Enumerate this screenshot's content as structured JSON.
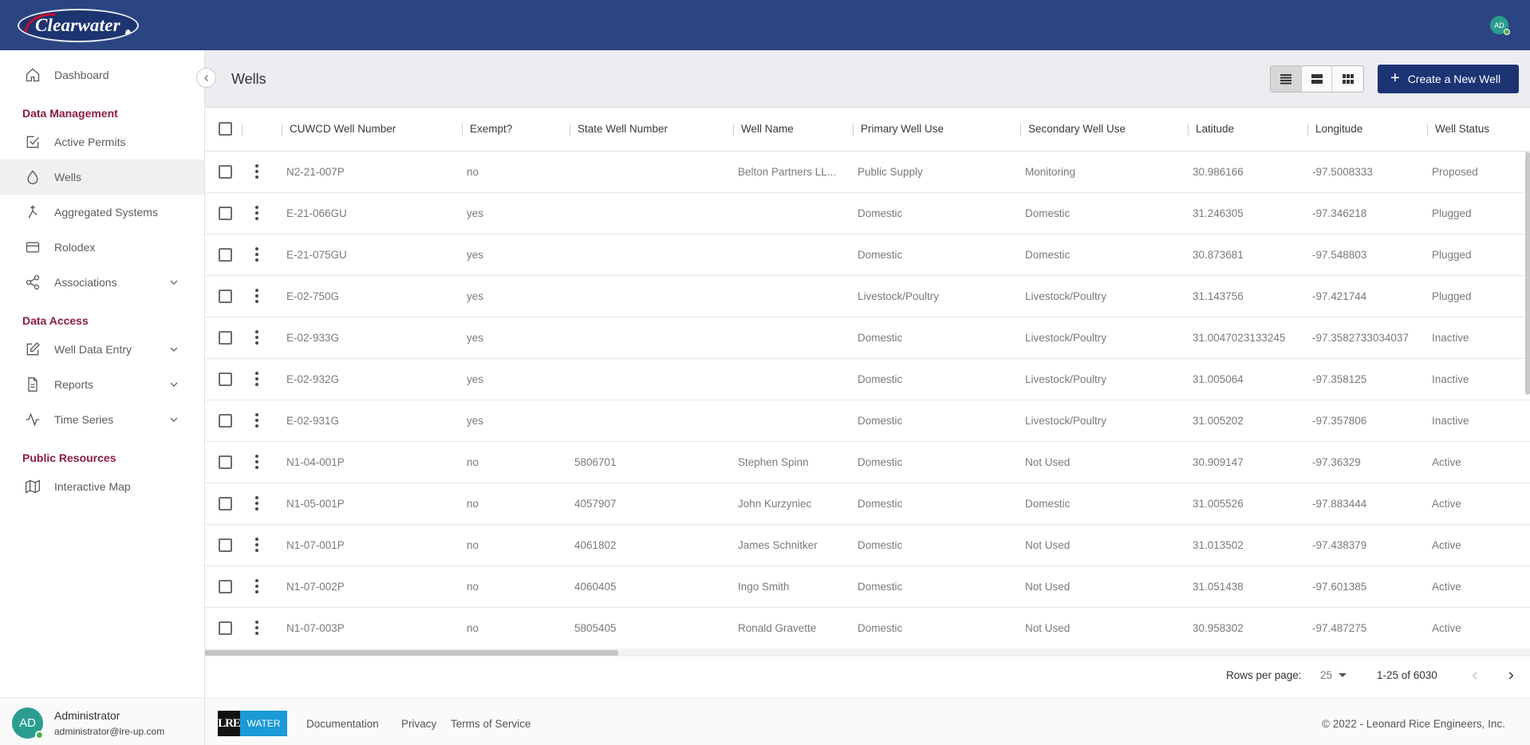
{
  "brand": {
    "logo_text": "Clearwater",
    "user_initials": "AD"
  },
  "sidebar": {
    "dashboard": "Dashboard",
    "sections": {
      "data_management": "Data Management",
      "data_access": "Data Access",
      "public_resources": "Public Resources"
    },
    "items": {
      "active_permits": "Active Permits",
      "wells": "Wells",
      "aggregated_systems": "Aggregated Systems",
      "rolodex": "Rolodex",
      "associations": "Associations",
      "well_data_entry": "Well Data Entry",
      "reports": "Reports",
      "time_series": "Time Series",
      "interactive_map": "Interactive Map"
    },
    "active_item": "Wells"
  },
  "user": {
    "initials": "AD",
    "name": "Administrator",
    "email": "administrator@lre-up.com"
  },
  "header": {
    "title": "Wells",
    "create_label": "Create a New Well"
  },
  "table": {
    "columns": [
      "CUWCD Well Number",
      "Exempt?",
      "State Well Number",
      "Well Name",
      "Primary Well Use",
      "Secondary Well Use",
      "Latitude",
      "Longitude",
      "Well Status"
    ],
    "rows": [
      [
        "N2-21-007P",
        "no",
        "",
        "Belton Partners LL...",
        "Public Supply",
        "Monitoring",
        "30.986166",
        "-97.5008333",
        "Proposed"
      ],
      [
        "E-21-066GU",
        "yes",
        "",
        "",
        "Domestic",
        "Domestic",
        "31.246305",
        "-97.346218",
        "Plugged"
      ],
      [
        "E-21-075GU",
        "yes",
        "",
        "",
        "Domestic",
        "Domestic",
        "30.873681",
        "-97.548803",
        "Plugged"
      ],
      [
        "E-02-750G",
        "yes",
        "",
        "",
        "Livestock/Poultry",
        "Livestock/Poultry",
        "31.143756",
        "-97.421744",
        "Plugged"
      ],
      [
        "E-02-933G",
        "yes",
        "",
        "",
        "Domestic",
        "Livestock/Poultry",
        "31.0047023133245",
        "-97.3582733034037",
        "Inactive"
      ],
      [
        "E-02-932G",
        "yes",
        "",
        "",
        "Domestic",
        "Livestock/Poultry",
        "31.005064",
        "-97.358125",
        "Inactive"
      ],
      [
        "E-02-931G",
        "yes",
        "",
        "",
        "Domestic",
        "Livestock/Poultry",
        "31.005202",
        "-97.357806",
        "Inactive"
      ],
      [
        "N1-04-001P",
        "no",
        "5806701",
        "Stephen Spinn",
        "Domestic",
        "Not Used",
        "30.909147",
        "-97.36329",
        "Active"
      ],
      [
        "N1-05-001P",
        "no",
        "4057907",
        "John Kurzyniec",
        "Domestic",
        "Domestic",
        "31.005526",
        "-97.883444",
        "Active"
      ],
      [
        "N1-07-001P",
        "no",
        "4061802",
        "James Schnitker",
        "Domestic",
        "Not Used",
        "31.013502",
        "-97.438379",
        "Active"
      ],
      [
        "N1-07-002P",
        "no",
        "4060405",
        "Ingo Smith",
        "Domestic",
        "Not Used",
        "31.051438",
        "-97.601385",
        "Active"
      ],
      [
        "N1-07-003P",
        "no",
        "5805405",
        "Ronald Gravette",
        "Domestic",
        "Not Used",
        "30.958302",
        "-97.487275",
        "Active"
      ]
    ]
  },
  "pagination": {
    "rows_per_page_label": "Rows per page:",
    "rows_per_page": "25",
    "range": "1-25 of 6030"
  },
  "footer": {
    "logo_left": "LRE",
    "logo_right": "WATER",
    "links": {
      "documentation": "Documentation",
      "privacy": "Privacy",
      "terms": "Terms of Service"
    },
    "copyright": "© 2022 - Leonard Rice Engineers, Inc."
  },
  "colors": {
    "topbar": "#2b4582",
    "primary_button": "#1c3474",
    "section_title": "#8c1d3d",
    "avatar": "#2a9d8f",
    "online": "#4caf50"
  }
}
